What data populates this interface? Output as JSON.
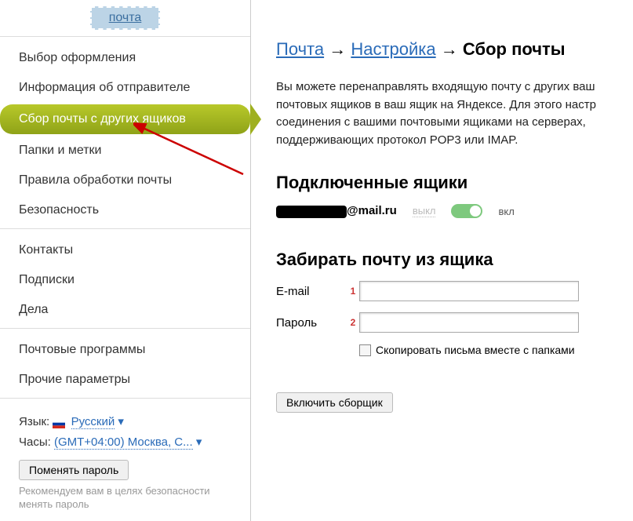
{
  "header": {
    "tab": "почта"
  },
  "sidebar": {
    "groups": [
      [
        "Выбор оформления",
        "Информация об отправителе",
        "Сбор почты с других ящиков",
        "Папки и метки",
        "Правила обработки почты",
        "Безопасность"
      ],
      [
        "Контакты",
        "Подписки",
        "Дела"
      ],
      [
        "Почтовые программы",
        "Прочие параметры"
      ]
    ],
    "active": "Сбор почты с других ящиков"
  },
  "footer": {
    "lang_label": "Язык:",
    "lang_value": "Русский",
    "clock_label": "Часы:",
    "clock_value": "(GMT+04:00) Москва, С...",
    "change_pw": "Поменять пароль",
    "note": "Рекомендуем вам в целях безопасности менять пароль"
  },
  "breadcrumb": {
    "l1": "Почта",
    "l2": "Настройка",
    "current": "Сбор почты"
  },
  "main": {
    "desc": "Вы можете перенаправлять входящую почту с других ваш почтовых ящиков в ваш ящик на Яндексе. Для этого настр соединения с вашими почтовыми ящиками на серверах, поддерживающих протокол POP3 или IMAP.",
    "connected_title": "Подключенные ящики",
    "mail_domain": "@mail.ru",
    "off": "выкл",
    "on": "вкл",
    "collect_title": "Забирать почту из ящика",
    "email_label": "E-mail",
    "password_label": "Пароль",
    "num1": "1",
    "num2": "2",
    "copy_checkbox": "Скопировать письма вместе с папками",
    "submit": "Включить сборщик"
  }
}
